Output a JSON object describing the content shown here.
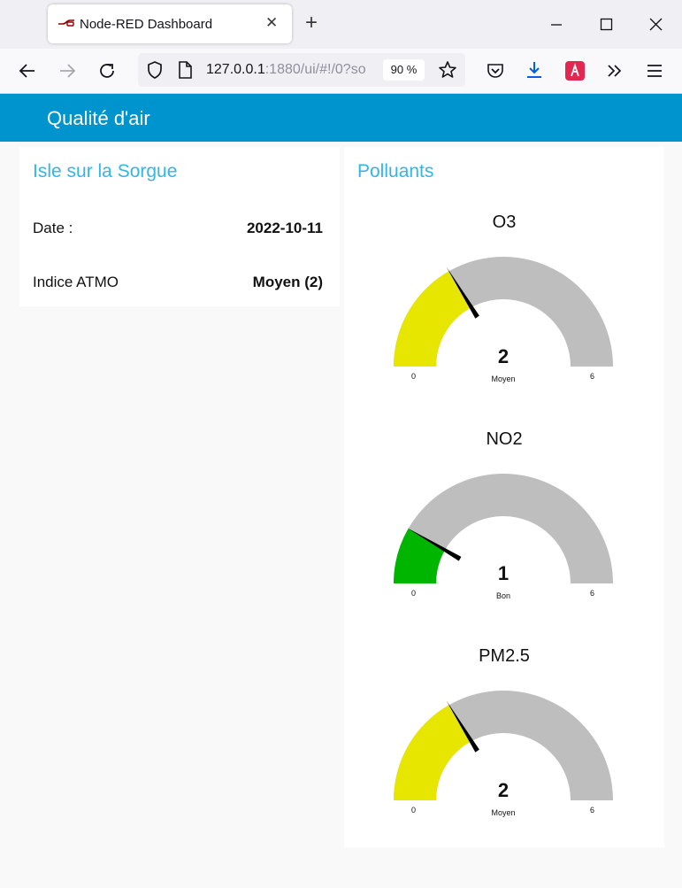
{
  "browser": {
    "tab_title": "Node-RED Dashboard",
    "url_host": "127.0.0.1",
    "url_rest": ":1880/ui/#!/0?so",
    "zoom": "90 %"
  },
  "app": {
    "title": "Qualité d'air"
  },
  "card_location": {
    "title": "Isle sur la Sorgue",
    "rows": [
      {
        "label": "Date :",
        "value": "2022-10-11"
      },
      {
        "label": "Indice ATMO",
        "value": "Moyen (2)"
      }
    ]
  },
  "card_pollutants": {
    "title": "Polluants",
    "gauges": [
      {
        "name": "O3",
        "value": "2",
        "unit": "Moyen",
        "min": "0",
        "max": "6",
        "color": "#e6e600"
      },
      {
        "name": "NO2",
        "value": "1",
        "unit": "Bon",
        "min": "0",
        "max": "6",
        "color": "#00b500"
      },
      {
        "name": "PM2.5",
        "value": "2",
        "unit": "Moyen",
        "min": "0",
        "max": "6",
        "color": "#e6e600"
      }
    ]
  },
  "colors": {
    "header": "#0094ce",
    "accent": "#33b5e5",
    "gauge_track": "#bebebe",
    "needle": "#000000"
  }
}
